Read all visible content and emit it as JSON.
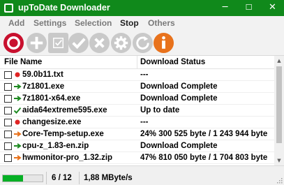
{
  "window": {
    "title": "upToDate Downloader",
    "minimize_glyph": "─",
    "maximize_glyph": "☐",
    "close_glyph": "✕"
  },
  "menu": [
    {
      "label": "Add",
      "active": false
    },
    {
      "label": "Settings",
      "active": false
    },
    {
      "label": "Selection",
      "active": false
    },
    {
      "label": "Stop",
      "active": true
    },
    {
      "label": "Others",
      "active": false
    }
  ],
  "toolbar": [
    {
      "name": "stop-icon",
      "color": "#c8102e",
      "enabled": true
    },
    {
      "name": "add-icon",
      "color": "#c9c9c9",
      "enabled": false
    },
    {
      "name": "select-icon",
      "color": "#c9c9c9",
      "enabled": false
    },
    {
      "name": "check-icon",
      "color": "#c9c9c9",
      "enabled": false
    },
    {
      "name": "remove-icon",
      "color": "#c9c9c9",
      "enabled": false
    },
    {
      "name": "settings-gear-icon",
      "color": "#c9c9c9",
      "enabled": false
    },
    {
      "name": "refresh-icon",
      "color": "#c9c9c9",
      "enabled": false
    },
    {
      "name": "info-icon",
      "color": "#e8721c",
      "enabled": true
    }
  ],
  "columns": {
    "file_name": "File Name",
    "status": "Download Status"
  },
  "files": [
    {
      "name": "59.0b11.txt",
      "status": "---",
      "icon": "red-dot-icon"
    },
    {
      "name": "7z1801.exe",
      "status": "Download Complete",
      "icon": "green-arrow-icon"
    },
    {
      "name": "7z1801-x64.exe",
      "status": "Download Complete",
      "icon": "green-arrow-icon"
    },
    {
      "name": "aida64extreme595.exe",
      "status": "Up to date",
      "icon": "green-check-icon"
    },
    {
      "name": "changesize.exe",
      "status": "---",
      "icon": "red-dot-icon"
    },
    {
      "name": "Core-Temp-setup.exe",
      "status": "24%   300 525 byte / 1 243 944 byte",
      "icon": "orange-arrow-icon"
    },
    {
      "name": "cpu-z_1.83-en.zip",
      "status": "Download Complete",
      "icon": "green-arrow-icon"
    },
    {
      "name": "hwmonitor-pro_1.32.zip",
      "status": "47%   810 050 byte / 1 704 803 byte",
      "icon": "orange-arrow-icon"
    }
  ],
  "scrollbar": {
    "up_glyph": "▲",
    "down_glyph": "▼"
  },
  "status": {
    "progress_fraction": 0.5,
    "count": "6 / 12",
    "speed": "1,88 MByte/s"
  },
  "colors": {
    "titlebar": "#10891b",
    "progress": "#06b025",
    "red_dot": "#e02424",
    "green": "#1f8a22",
    "orange": "#e8721c"
  }
}
